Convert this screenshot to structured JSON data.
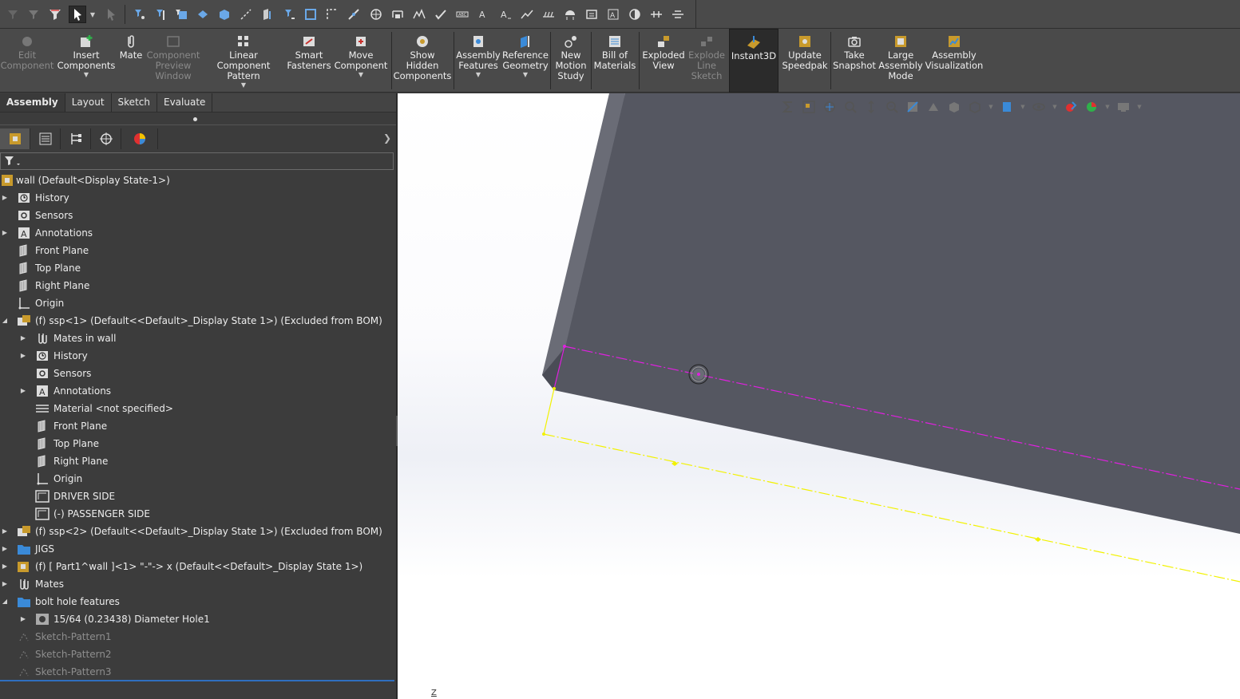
{
  "ribbon": {
    "edit_component": "Edit\nComponent",
    "insert_components": "Insert\nComponents",
    "mate": "Mate",
    "component_preview": "Component\nPreview\nWindow",
    "linear_pattern": "Linear Component\nPattern",
    "smart_fasteners": "Smart\nFasteners",
    "move_component": "Move\nComponent",
    "show_hidden": "Show\nHidden\nComponents",
    "assembly_features": "Assembly\nFeatures",
    "reference_geometry": "Reference\nGeometry",
    "new_motion_study": "New\nMotion\nStudy",
    "bill_of_materials": "Bill of\nMaterials",
    "exploded_view": "Exploded\nView",
    "explode_line_sketch": "Explode\nLine\nSketch",
    "instant3d": "Instant3D",
    "update_speedpak": "Update\nSpeedpak",
    "take_snapshot": "Take\nSnapshot",
    "large_assembly_mode": "Large\nAssembly\nMode",
    "assembly_visualization": "Assembly\nVisualization"
  },
  "tabs": [
    "Assembly",
    "Layout",
    "Sketch",
    "Evaluate"
  ],
  "tree": {
    "root": "wall  (Default<Display State-1>)",
    "items": [
      "History",
      "Sensors",
      "Annotations",
      "Front Plane",
      "Top Plane",
      "Right Plane",
      "Origin",
      "(f) ssp<1> (Default<<Default>_Display State 1>) (Excluded from BOM)",
      "Mates in wall",
      "History",
      "Sensors",
      "Annotations",
      "Material <not specified>",
      "Front Plane",
      "Top Plane",
      "Right Plane",
      "Origin",
      "DRIVER SIDE",
      "(-) PASSENGER SIDE",
      "(f) ssp<2> (Default<<Default>_Display State 1>) (Excluded from BOM)",
      "JIGS",
      "(f) [ Part1^wall ]<1> \"-\"-> x (Default<<Default>_Display State 1>)",
      "Mates",
      "bolt hole features",
      "15/64 (0.23438) Diameter Hole1",
      "Sketch-Pattern1",
      "Sketch-Pattern2",
      "Sketch-Pattern3"
    ]
  },
  "viewport": {
    "axis_label": "Z"
  },
  "colors": {
    "panel_bg": "#3c3c3c",
    "toolbar_bg": "#4a4a4a",
    "part_face": "#555761",
    "sketch_magenta": "#e020e0",
    "sketch_yellow": "#f2f200",
    "selection_blue": "#2f6fbf"
  }
}
